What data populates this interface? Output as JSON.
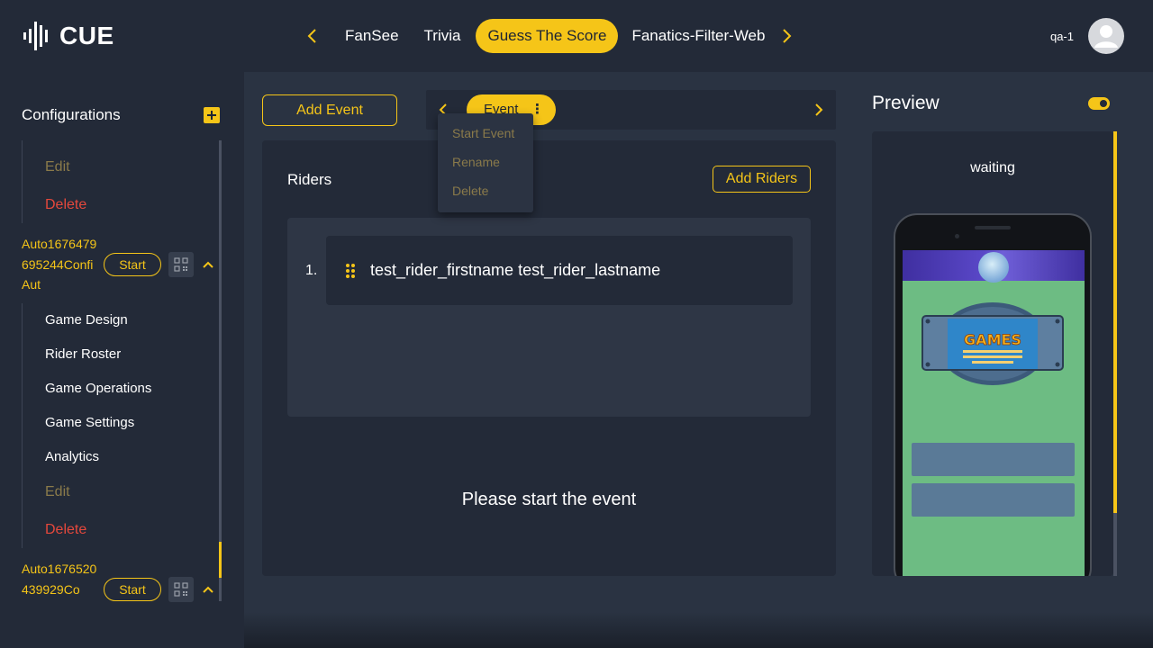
{
  "header": {
    "logo_text": "CUE",
    "tabs": [
      "FanSee",
      "Trivia",
      "Guess The Score",
      "Fanatics-Filter-Web"
    ],
    "active_tab": "Guess The Score",
    "user_name": "qa-1"
  },
  "colors": {
    "accent": "#f5c518",
    "danger": "#e5483c",
    "bg": "#2a3342",
    "panel": "#232a38"
  },
  "sidebar": {
    "title": "Configurations",
    "top_actions": {
      "edit": "Edit",
      "delete": "Delete"
    },
    "configs": [
      {
        "name": "Auto1676479695244ConfiAut",
        "start_label": "Start",
        "menu": [
          "Game Design",
          "Rider Roster",
          "Game Operations",
          "Game Settings",
          "Analytics"
        ],
        "edit": "Edit",
        "delete": "Delete"
      },
      {
        "name": "Auto1676520439929Co",
        "start_label": "Start"
      }
    ]
  },
  "main": {
    "add_event_label": "Add Event",
    "event_chip_label": "Event",
    "event_menu": [
      "Start Event",
      "Rename",
      "Delete"
    ],
    "riders_title": "Riders",
    "add_riders_label": "Add Riders",
    "riders": [
      {
        "number": "1.",
        "name": "test_rider_firstname test_rider_lastname"
      }
    ],
    "status_message": "Please start the event"
  },
  "preview": {
    "title": "Preview",
    "toggle_on": true,
    "status": "waiting",
    "game_logo_text": "GAMES"
  }
}
